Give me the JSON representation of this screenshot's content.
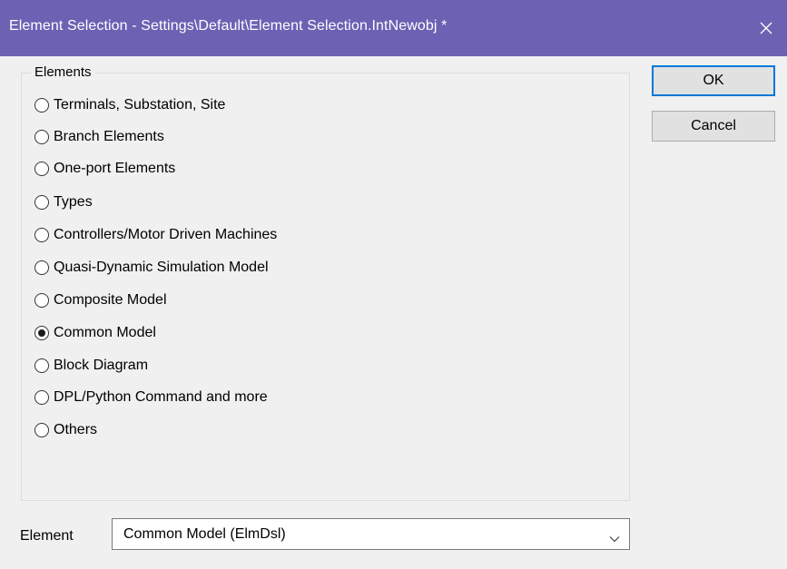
{
  "window": {
    "title": "Element Selection - Settings\\Default\\Element Selection.IntNewobj *",
    "title_bar_color": "#6b62b4",
    "close_icon": "close-icon"
  },
  "group": {
    "legend": "Elements",
    "options": [
      {
        "label": "Terminals, Substation, Site",
        "checked": false
      },
      {
        "label": "Branch Elements",
        "checked": false
      },
      {
        "label": "One-port Elements",
        "checked": false
      },
      {
        "label": "Types",
        "checked": false
      },
      {
        "label": "Controllers/Motor Driven Machines",
        "checked": false
      },
      {
        "label": "Quasi-Dynamic Simulation Model",
        "checked": false
      },
      {
        "label": "Composite Model",
        "checked": false
      },
      {
        "label": "Common Model",
        "checked": true
      },
      {
        "label": "Block Diagram",
        "checked": false
      },
      {
        "label": "DPL/Python Command and more",
        "checked": false
      },
      {
        "label": "Others",
        "checked": false
      }
    ]
  },
  "buttons": {
    "ok_label": "OK",
    "cancel_label": "Cancel",
    "accent_color": "#0078d7"
  },
  "element": {
    "label": "Element",
    "selected_value": "Common Model (ElmDsl)",
    "dropdown_icon": "chevron-down-icon"
  }
}
